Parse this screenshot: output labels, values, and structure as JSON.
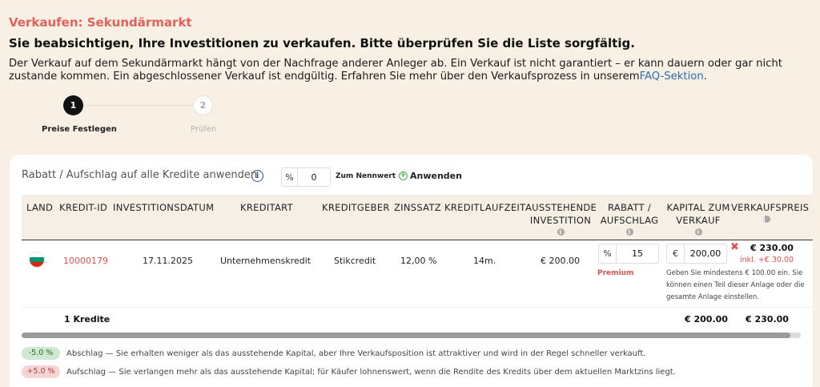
{
  "page": {
    "title": "Verkaufen: Sekundärmarkt",
    "headline": "Sie beabsichtigen, Ihre Investitionen zu verkaufen. Bitte überprüfen Sie die Liste sorgfältig.",
    "description": "Der Verkauf auf dem Sekundärmarkt hängt von der Nachfrage anderer Anleger ab. Ein Verkauf ist nicht garantiert – er kann dauern oder gar nicht zustande kommen. Ein abgeschlossener Verkauf ist endgültig. Erfahren Sie mehr über den Verkaufsprozess in unserem",
    "faq_link": "FAQ-Sektion",
    "description_end": "."
  },
  "steps": [
    {
      "number": "1",
      "label": "Preise Festlegen",
      "active": true
    },
    {
      "number": "2",
      "label": "Prüfen",
      "active": false
    }
  ],
  "bulk": {
    "label": "Rabatt / Aufschlag auf alle Kredite anwenden",
    "prefix": "%",
    "value": "0",
    "nennwert": "Zum Nennwert",
    "apply": "Anwenden"
  },
  "table": {
    "headers": {
      "land": "LAND",
      "kredit_id": "KREDIT-ID",
      "investitionsdatum": "INVESTITIONSDATUM",
      "kreditart": "KREDITART",
      "kreditgeber": "KREDITGEBER",
      "zinssatz": "ZINSSATZ",
      "laufzeit": "KREDITLAUFZEIT",
      "ausstehend_1": "AUSSTEHENDE",
      "ausstehend_2": "INVESTITION",
      "rabatt_1": "RABATT /",
      "rabatt_2": "AUFSCHLAG",
      "kapital_1": "KAPITAL ZUM",
      "kapital_2": "VERKAUF",
      "verkaufspreis": "VERKAUFSPREIS"
    },
    "row": {
      "country": "Bulgaria",
      "kredit_id": "10000179",
      "investitionsdatum": "17.11.2025",
      "kreditart": "Unternehmenskredit",
      "kreditgeber": "Stikcredit",
      "zinssatz": "12,00 %",
      "laufzeit": "14m.",
      "ausstehend": "€ 200.00",
      "rabatt_prefix": "%",
      "rabatt_value": "15",
      "rabatt_tag": "Premium",
      "kapital_prefix": "€",
      "kapital_value": "200,00",
      "hint": "Geben Sie mindestens € 100.00 ein. Sie können einen Teil dieser Anlage oder die gesamte Anlage einstellen.",
      "verkaufspreis": "€ 230.00",
      "verkaufspreis_sub": "inkl. +€ 30.00"
    },
    "footer": {
      "count": "1 Kredite",
      "kapital_total": "€ 200.00",
      "verkaufspreis_total": "€ 230.00"
    }
  },
  "legend": [
    {
      "badge": "-5.0 %",
      "text": "Abschlag — Sie erhalten weniger als das ausstehende Kapital, aber Ihre Verkaufsposition ist attraktiver und wird in der Regel schneller verkauft."
    },
    {
      "badge": "+5.0 %",
      "text": "Aufschlag — Sie verlangen mehr als das ausstehende Kapital; für Käufer lohnenswert, wenn die Rendite des Kredits über dem aktuellen Marktzins liegt."
    }
  ],
  "colors": {
    "accent": "#e0625c",
    "link": "#2a6ea8",
    "background": "#f8efe5"
  }
}
